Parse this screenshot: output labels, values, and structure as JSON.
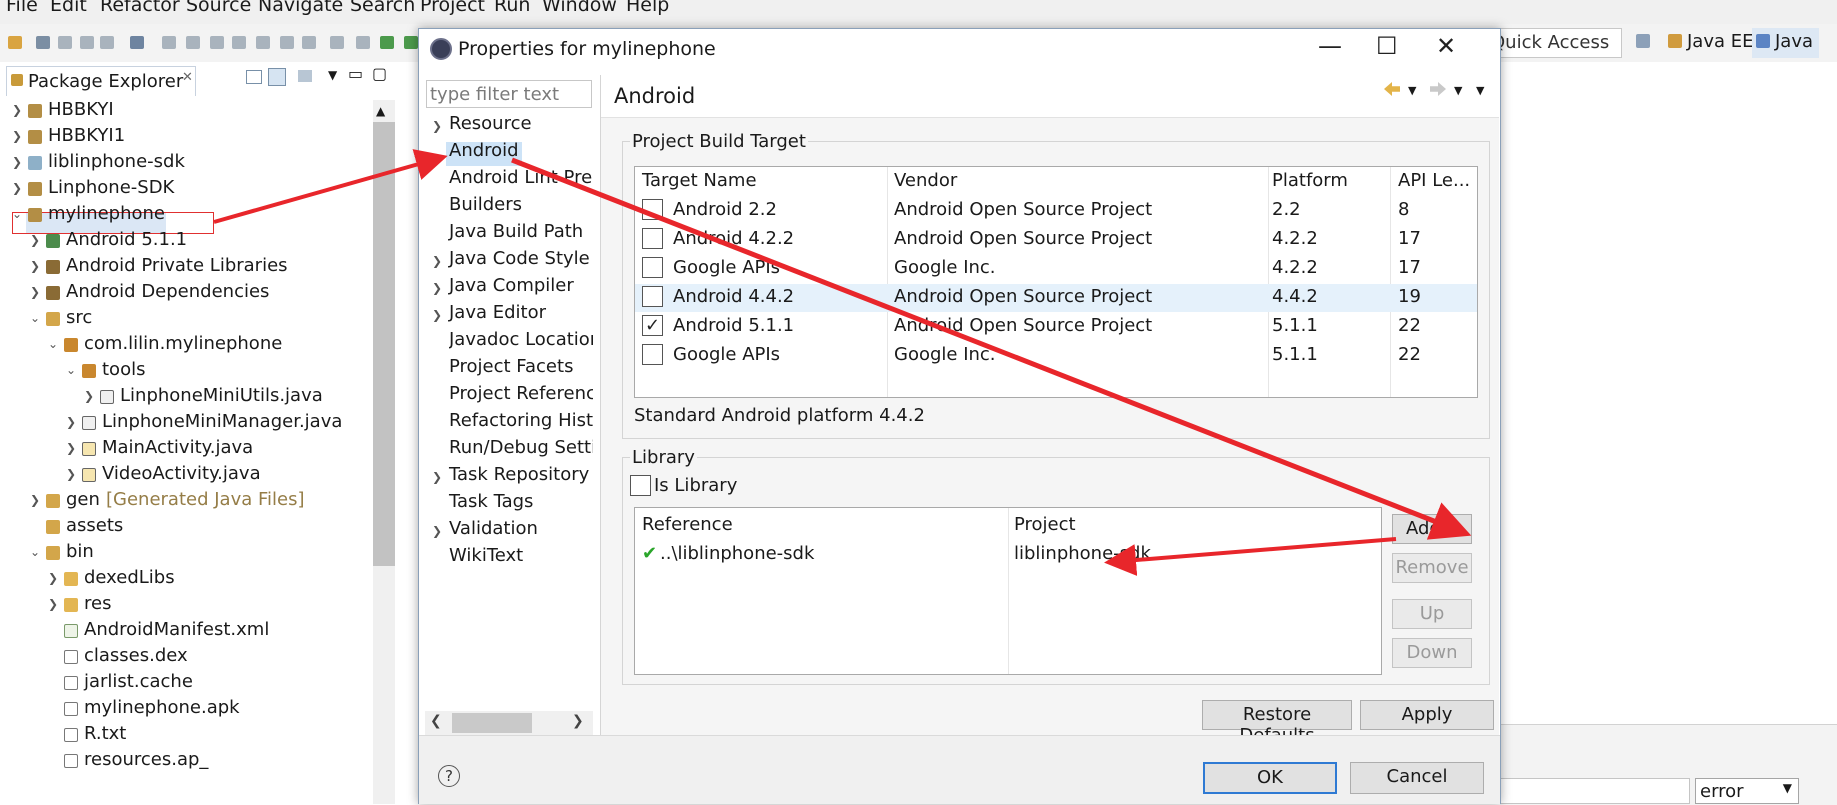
{
  "menu": [
    "File",
    "Edit",
    "Refactor",
    "Source",
    "Navigate",
    "Search",
    "Project",
    "Run",
    "Window",
    "Help"
  ],
  "toolbar": {
    "quick_access": "Quick Access",
    "perspectives": [
      "Java EE",
      "Java"
    ]
  },
  "package_explorer": {
    "title": "Package Explorer",
    "tree": [
      {
        "label": "HBBKYI",
        "extra": ""
      },
      {
        "label": "HBBKYI1",
        "extra": ""
      },
      {
        "label": "liblinphone-sdk",
        "extra": ""
      },
      {
        "label": "Linphone-SDK",
        "extra": ""
      },
      {
        "label": "mylinephone",
        "extra": ""
      },
      {
        "label": "Android 5.1.1",
        "extra": ""
      },
      {
        "label": "Android Private Libraries",
        "extra": ""
      },
      {
        "label": "Android Dependencies",
        "extra": ""
      },
      {
        "label": "src",
        "extra": ""
      },
      {
        "label": "com.lilin.mylinephone",
        "extra": ""
      },
      {
        "label": "tools",
        "extra": ""
      },
      {
        "label": "LinphoneMiniUtils.java",
        "extra": ""
      },
      {
        "label": "LinphoneMiniManager.java",
        "extra": ""
      },
      {
        "label": "MainActivity.java",
        "extra": ""
      },
      {
        "label": "VideoActivity.java",
        "extra": ""
      },
      {
        "label": "gen",
        "extra": "[Generated Java Files]"
      },
      {
        "label": "assets",
        "extra": ""
      },
      {
        "label": "bin",
        "extra": ""
      },
      {
        "label": "dexedLibs",
        "extra": ""
      },
      {
        "label": "res",
        "extra": ""
      },
      {
        "label": "AndroidManifest.xml",
        "extra": ""
      },
      {
        "label": "classes.dex",
        "extra": ""
      },
      {
        "label": "jarlist.cache",
        "extra": ""
      },
      {
        "label": "mylinephone.apk",
        "extra": ""
      },
      {
        "label": "R.txt",
        "extra": ""
      },
      {
        "label": "resources.ap_",
        "extra": ""
      }
    ]
  },
  "dialog": {
    "title": "Properties for mylinephone",
    "filter_placeholder": "type filter text",
    "nav_items": [
      "Resource",
      "Android",
      "Android Lint Pre",
      "Builders",
      "Java Build Path",
      "Java Code Style",
      "Java Compiler",
      "Java Editor",
      "Javadoc Locatior",
      "Project Facets",
      "Project Reference",
      "Refactoring Histo",
      "Run/Debug Setti",
      "Task Repository",
      "Task Tags",
      "Validation",
      "WikiText"
    ],
    "page_title": "Android",
    "build_target": {
      "group_label": "Project Build Target",
      "columns": [
        "Target Name",
        "Vendor",
        "Platform",
        "API Le..."
      ],
      "rows": [
        {
          "name": "Android 2.2",
          "vendor": "Android Open Source Project",
          "platform": "2.2",
          "api": "8",
          "checked": false
        },
        {
          "name": "Android 4.2.2",
          "vendor": "Android Open Source Project",
          "platform": "4.2.2",
          "api": "17",
          "checked": false
        },
        {
          "name": "Google APIs",
          "vendor": "Google Inc.",
          "platform": "4.2.2",
          "api": "17",
          "checked": false
        },
        {
          "name": "Android 4.4.2",
          "vendor": "Android Open Source Project",
          "platform": "4.4.2",
          "api": "19",
          "checked": false
        },
        {
          "name": "Android 5.1.1",
          "vendor": "Android Open Source Project",
          "platform": "5.1.1",
          "api": "22",
          "checked": true
        },
        {
          "name": "Google APIs",
          "vendor": "Google Inc.",
          "platform": "5.1.1",
          "api": "22",
          "checked": false
        }
      ],
      "status": "Standard Android platform 4.4.2"
    },
    "library": {
      "group_label": "Library",
      "is_library_label": "Is Library",
      "columns": [
        "Reference",
        "Project"
      ],
      "rows": [
        {
          "reference": "..\\liblinphone-sdk",
          "project": "liblinphone-sdk"
        }
      ],
      "buttons": [
        "Add...",
        "Remove",
        "Up",
        "Down"
      ]
    },
    "restore_defaults": "Restore Defaults",
    "apply": "Apply",
    "ok": "OK",
    "cancel": "Cancel"
  },
  "problems_filter": "error",
  "colors": {
    "arrow": "#e8262b",
    "selection": "#cde3f7",
    "row_highlight": "#e5f1fb",
    "default_button_border": "#2f7ad3"
  }
}
